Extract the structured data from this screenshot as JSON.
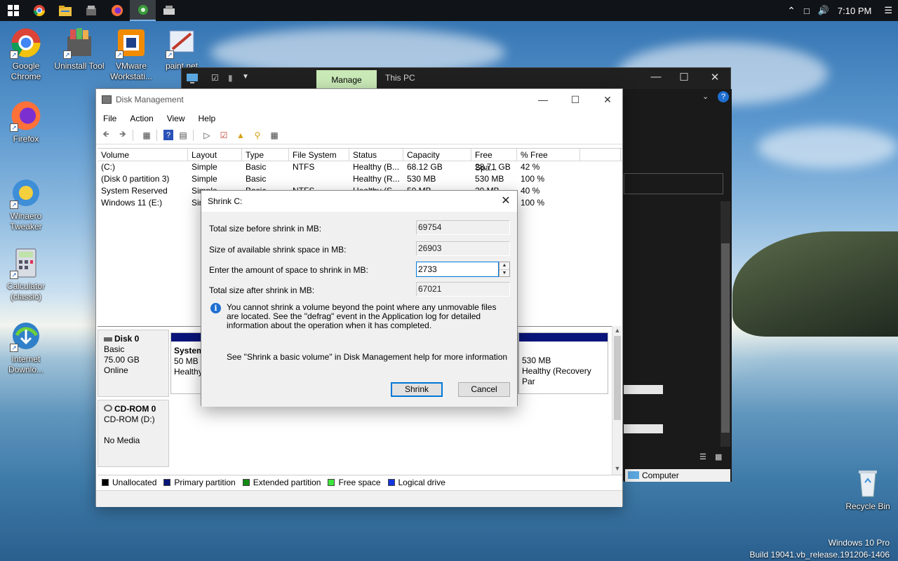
{
  "taskbar": {
    "time": "7:10 PM",
    "apps": [
      {
        "icon": "windows-start-icon"
      },
      {
        "icon": "chrome-icon"
      },
      {
        "icon": "file-explorer-icon"
      },
      {
        "icon": "uninstall-tool-icon"
      },
      {
        "icon": "firefox-icon"
      },
      {
        "icon": "winaero-tweaker-icon"
      },
      {
        "icon": "disk-management-icon"
      }
    ]
  },
  "desktop": {
    "icons": [
      {
        "label": "Google Chrome",
        "icon": "chrome-icon"
      },
      {
        "label": "Uninstall Tool",
        "icon": "uninstall-tool-icon"
      },
      {
        "label": "VMware Workstati...",
        "icon": "vmware-icon"
      },
      {
        "label": "paint.net",
        "icon": "paint-net-icon"
      },
      {
        "label": "Firefox",
        "icon": "firefox-icon"
      },
      {
        "label": "Winaero Tweaker",
        "icon": "winaero-tweaker-icon"
      },
      {
        "label": "Calculator (classic)",
        "icon": "calculator-icon"
      },
      {
        "label": "Internet Downlo...",
        "icon": "internet-download-manager-icon"
      },
      {
        "label": "Recycle Bin",
        "icon": "recycle-bin-icon"
      }
    ],
    "watermark": {
      "line1": "Windows 10 Pro",
      "line2": "Build 19041.vb_release.191206-1406"
    }
  },
  "explorer": {
    "tab_manage": "Manage",
    "tab_title": "This PC",
    "status_item": "Computer"
  },
  "disk_management": {
    "title": "Disk Management",
    "menu": [
      "File",
      "Action",
      "View",
      "Help"
    ],
    "columns": [
      "Volume",
      "Layout",
      "Type",
      "File System",
      "Status",
      "Capacity",
      "Free Spa...",
      "% Free"
    ],
    "volumes": [
      [
        "(C:)",
        "Simple",
        "Basic",
        "NTFS",
        "Healthy (B...",
        "68.12 GB",
        "28.71 GB",
        "42 %"
      ],
      [
        "(Disk 0 partition 3)",
        "Simple",
        "Basic",
        "",
        "Healthy (R...",
        "530 MB",
        "530 MB",
        "100 %"
      ],
      [
        "System Reserved",
        "Simple",
        "Basic",
        "NTFS",
        "Healthy (S...",
        "50 MB",
        "20 MB",
        "40 %"
      ],
      [
        "Windows 11 (E:)",
        "Simple",
        "",
        "",
        "",
        "",
        "",
        "100 %"
      ]
    ],
    "disk0": {
      "name": "Disk 0",
      "type": "Basic",
      "size": "75.00 GB",
      "state": "Online"
    },
    "disk0_part_system": {
      "name": "System",
      "size": "50 MB",
      "status": "Healthy"
    },
    "disk0_part_recovery": {
      "size": "530 MB",
      "status": "Healthy (Recovery Par"
    },
    "cdrom": {
      "name": "CD-ROM 0",
      "type": "CD-ROM (D:)",
      "state": "No Media"
    },
    "legend": [
      {
        "label": "Unallocated",
        "color": "#000000"
      },
      {
        "label": "Primary partition",
        "color": "#09157a"
      },
      {
        "label": "Extended partition",
        "color": "#138a13"
      },
      {
        "label": "Free space",
        "color": "#3ee63e"
      },
      {
        "label": "Logical drive",
        "color": "#1436e0"
      }
    ]
  },
  "shrink_dialog": {
    "title": "Shrink C:",
    "total_before_label": "Total size before shrink in MB:",
    "total_before_value": "69754",
    "available_label": "Size of available shrink space in MB:",
    "available_value": "26903",
    "amount_label": "Enter the amount of space to shrink in MB:",
    "amount_value": "2733",
    "total_after_label": "Total size after shrink in MB:",
    "total_after_value": "67021",
    "info_text": "You cannot shrink a volume beyond the point where any unmovable files are located. See the \"defrag\" event in the Application log for detailed information about the operation when it has completed.",
    "help_text": "See \"Shrink a basic volume\" in Disk Management help for more information",
    "shrink_button": "Shrink",
    "cancel_button": "Cancel"
  }
}
